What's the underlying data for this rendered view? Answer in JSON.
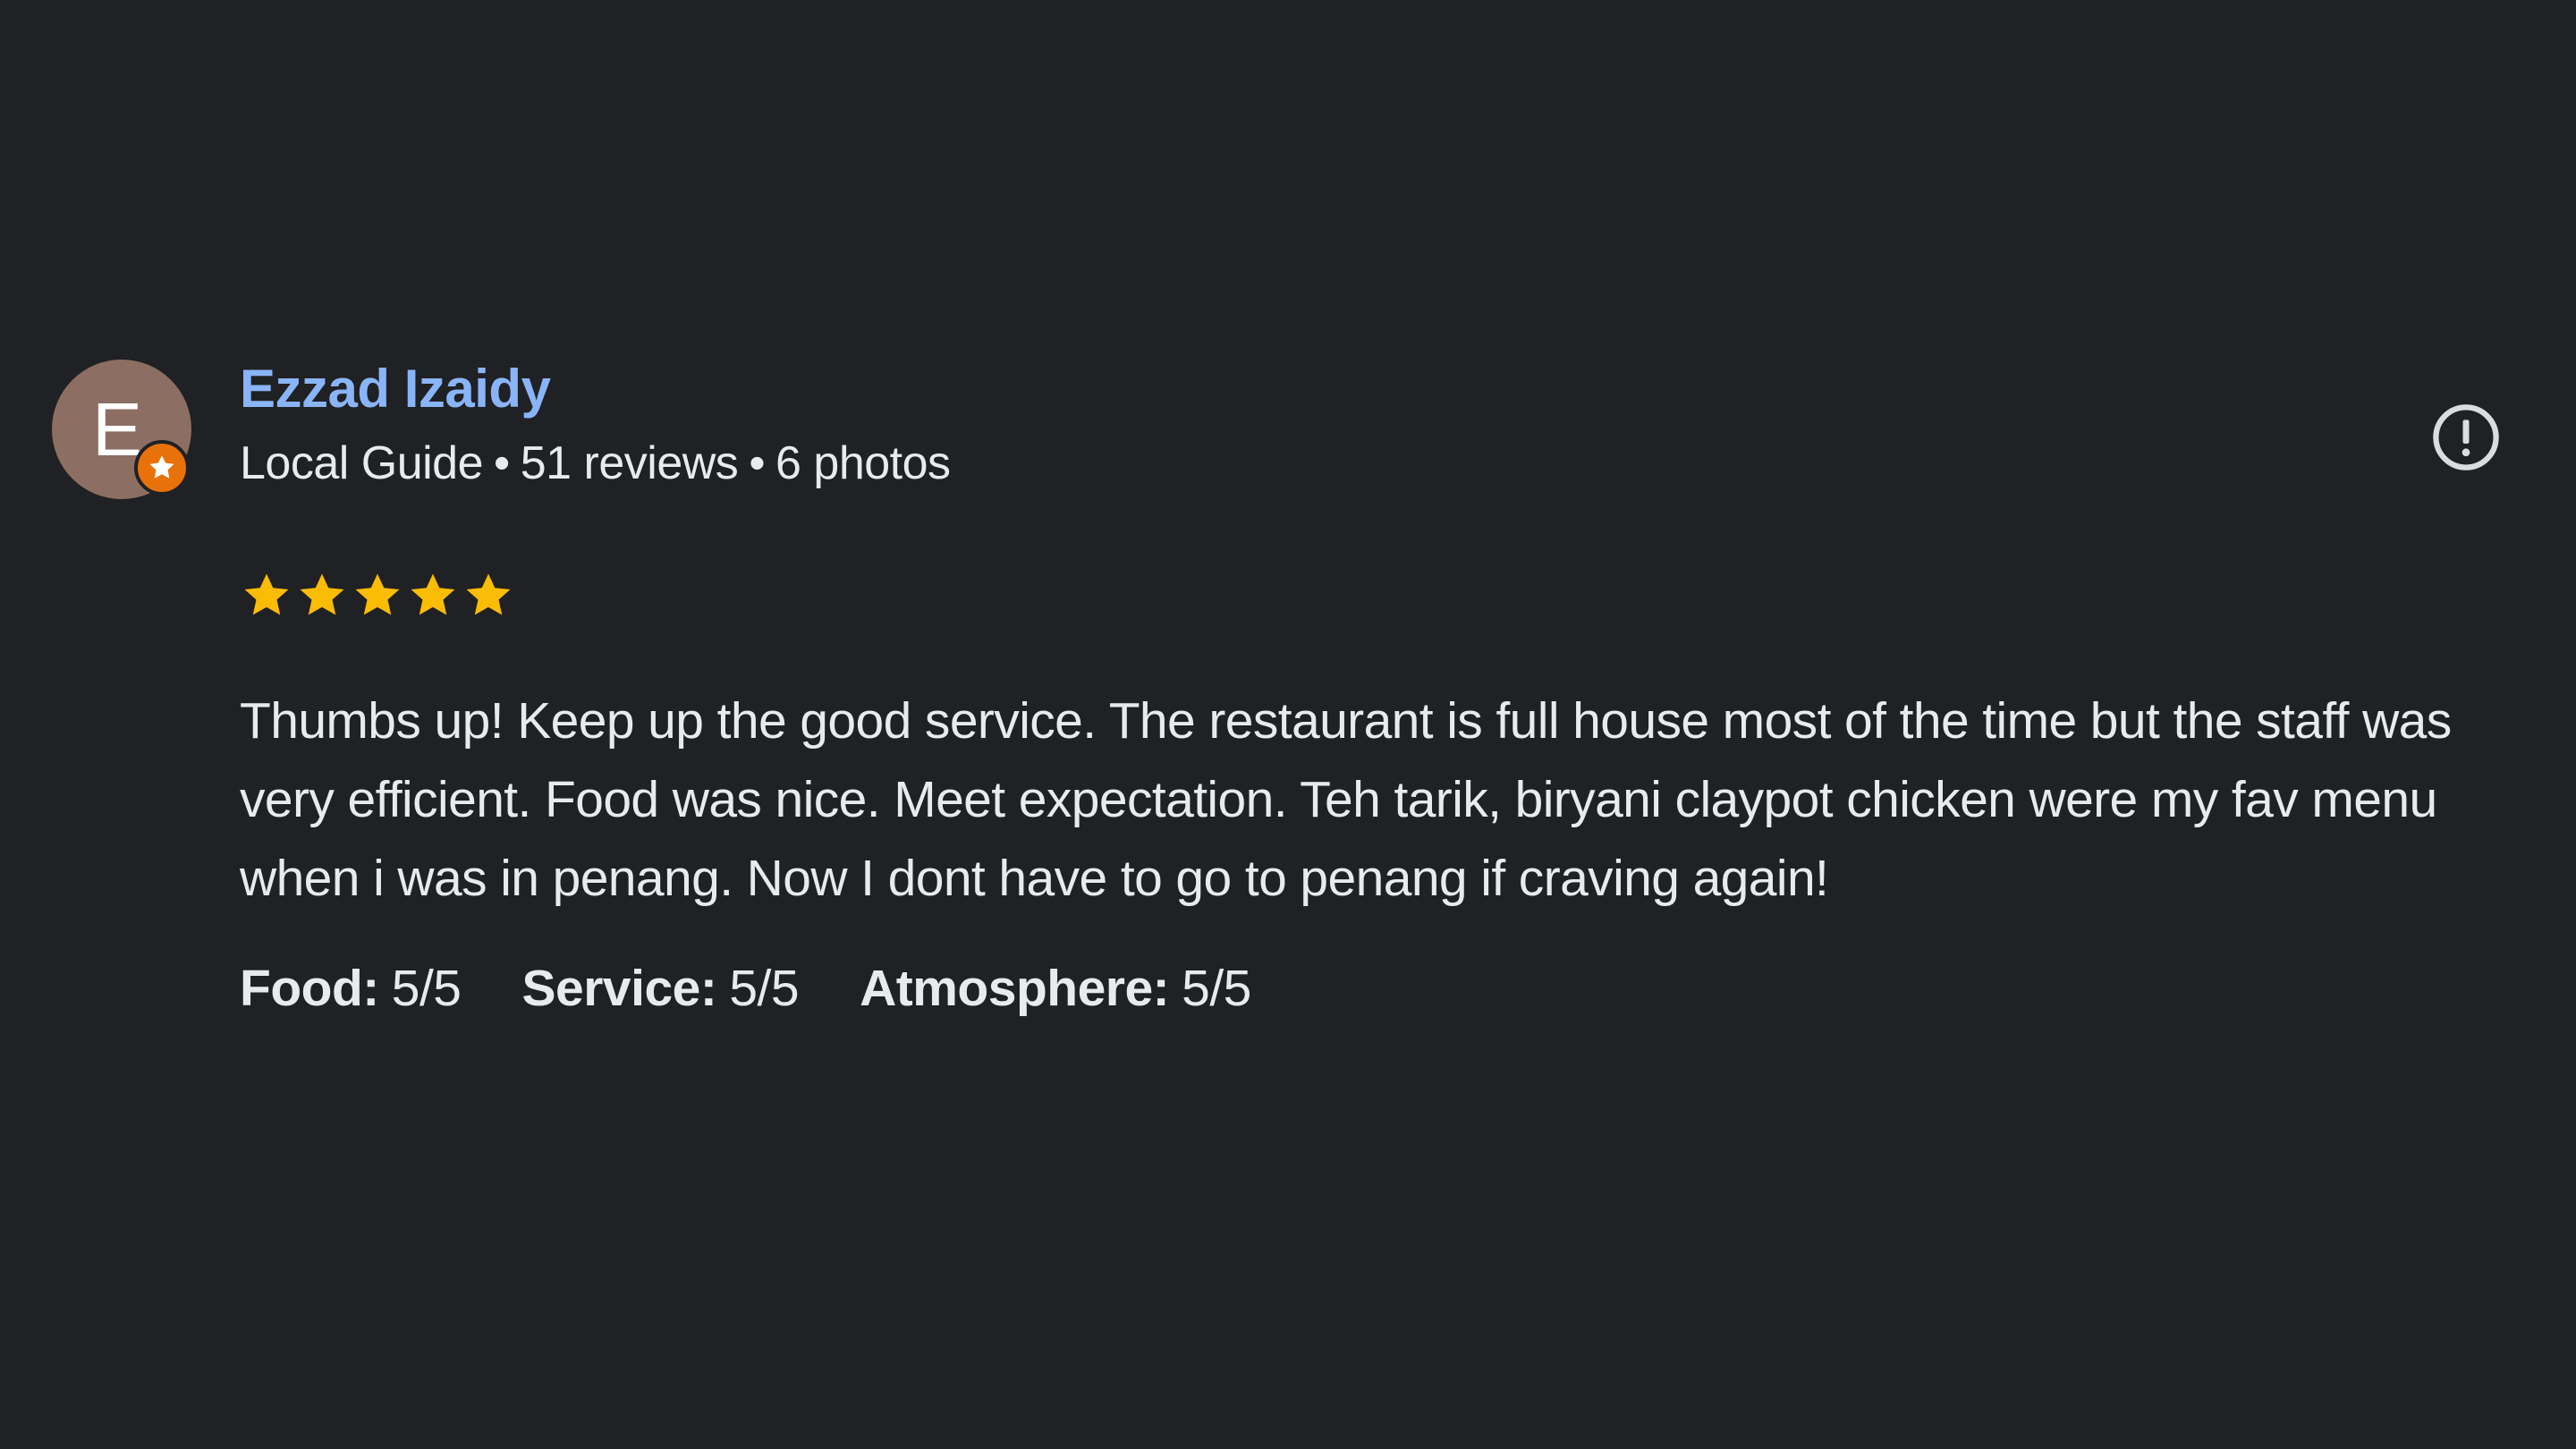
{
  "review": {
    "avatar_letter": "E",
    "reviewer_name": "Ezzad Izaidy",
    "reviewer_type": "Local Guide",
    "review_count": "51 reviews",
    "photo_count": "6 photos",
    "meta_separator": "•",
    "rating": 5,
    "rating_max": 5,
    "text": "Thumbs up! Keep up the good service. The restaurant is full house most of the time but the staff was very efficient. Food was nice. Meet expectation. Teh tarik, biryani claypot chicken were my fav menu when i was in penang. Now I dont have to go to penang if craving again!",
    "attributes": [
      {
        "label": "Food:",
        "value": "5/5"
      },
      {
        "label": "Service:",
        "value": "5/5"
      },
      {
        "label": "Atmosphere:",
        "value": "5/5"
      }
    ]
  },
  "colors": {
    "background": "#202124",
    "name_link": "#8ab4f8",
    "text": "#e8eaed",
    "star": "#fbbc04",
    "avatar": "#8d6e63",
    "guide_badge": "#e8710a"
  },
  "icons": {
    "guide_badge": "star-badge-icon",
    "report": "report-icon",
    "star": "star-icon"
  }
}
